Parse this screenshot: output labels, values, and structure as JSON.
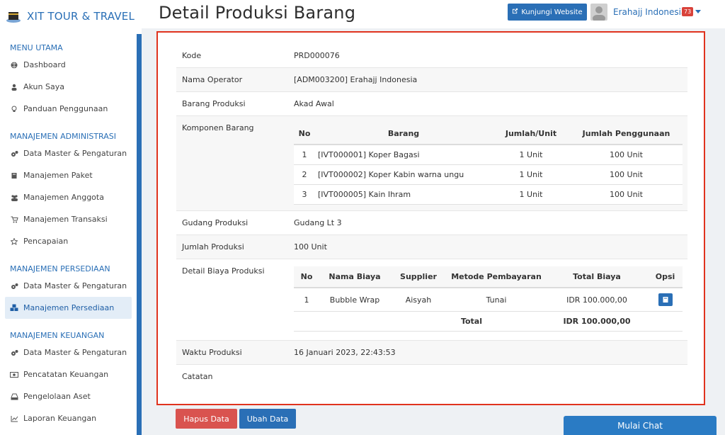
{
  "brand": {
    "title": "XIT TOUR & TRAVEL"
  },
  "header": {
    "title": "Detail Produksi Barang",
    "visit_label": "Kunjungi Website",
    "user_name": "Erahajj Indonesia",
    "notif_count": "73"
  },
  "sidebar": {
    "sections": [
      {
        "title": "MENU UTAMA",
        "items": [
          {
            "label": "Dashboard",
            "icon": "globe-icon"
          },
          {
            "label": "Akun Saya",
            "icon": "user-icon"
          },
          {
            "label": "Panduan Penggunaan",
            "icon": "lightbulb-icon"
          }
        ]
      },
      {
        "title": "MANAJEMEN ADMINISTRASI",
        "items": [
          {
            "label": "Data Master & Pengaturan",
            "icon": "gears-icon"
          },
          {
            "label": "Manajemen Paket",
            "icon": "book-icon"
          },
          {
            "label": "Manajemen Anggota",
            "icon": "users-icon"
          },
          {
            "label": "Manajemen Transaksi",
            "icon": "cart-icon"
          },
          {
            "label": "Pencapaian",
            "icon": "star-icon"
          }
        ]
      },
      {
        "title": "MANAJEMEN PERSEDIAAN",
        "items": [
          {
            "label": "Data Master & Pengaturan",
            "icon": "gears-icon"
          },
          {
            "label": "Manajemen Persediaan",
            "icon": "cubes-icon",
            "active": true
          }
        ]
      },
      {
        "title": "MANAJEMEN KEUANGAN",
        "items": [
          {
            "label": "Data Master & Pengaturan",
            "icon": "gears-icon"
          },
          {
            "label": "Pencatatan Keuangan",
            "icon": "money-icon"
          },
          {
            "label": "Pengelolaan Aset",
            "icon": "drive-icon"
          },
          {
            "label": "Laporan Keuangan",
            "icon": "chart-icon"
          }
        ]
      }
    ]
  },
  "detail": {
    "kode_label": "Kode",
    "kode": "PRD000076",
    "operator_label": "Nama Operator",
    "operator": "[ADM003200] Erahajj Indonesia",
    "barang_label": "Barang Produksi",
    "barang": "Akad Awal",
    "komponen_label": "Komponen Barang",
    "komponen_headers": {
      "no": "No",
      "barang": "Barang",
      "unit": "Jumlah/Unit",
      "penggunaan": "Jumlah Penggunaan"
    },
    "komponen": [
      {
        "no": "1",
        "barang": "[IVT000001] Koper Bagasi",
        "unit": "1 Unit",
        "penggunaan": "100 Unit"
      },
      {
        "no": "2",
        "barang": "[IVT000002] Koper Kabin warna ungu",
        "unit": "1 Unit",
        "penggunaan": "100 Unit"
      },
      {
        "no": "3",
        "barang": "[IVT000005] Kain Ihram",
        "unit": "1 Unit",
        "penggunaan": "100 Unit"
      }
    ],
    "gudang_label": "Gudang Produksi",
    "gudang": "Gudang Lt 3",
    "jumlah_label": "Jumlah Produksi",
    "jumlah": "100 Unit",
    "biaya_label": "Detail Biaya Produksi",
    "biaya_headers": {
      "no": "No",
      "nama": "Nama Biaya",
      "supplier": "Supplier",
      "metode": "Metode Pembayaran",
      "total": "Total Biaya",
      "opsi": "Opsi"
    },
    "biaya": [
      {
        "no": "1",
        "nama": "Bubble Wrap",
        "supplier": "Aisyah",
        "metode": "Tunai",
        "total": "IDR 100.000,00"
      }
    ],
    "biaya_total_label": "Total",
    "biaya_total": "IDR 100.000,00",
    "waktu_label": "Waktu Produksi",
    "waktu": "16 Januari 2023, 22:43:53",
    "catatan_label": "Catatan",
    "catatan": ""
  },
  "actions": {
    "delete_label": "Hapus Data",
    "edit_label": "Ubah Data"
  },
  "chat": {
    "label": "Mulai Chat"
  },
  "colors": {
    "primary": "#2a6fb6",
    "danger": "#d9534f",
    "highlight_border": "#e0331e"
  }
}
